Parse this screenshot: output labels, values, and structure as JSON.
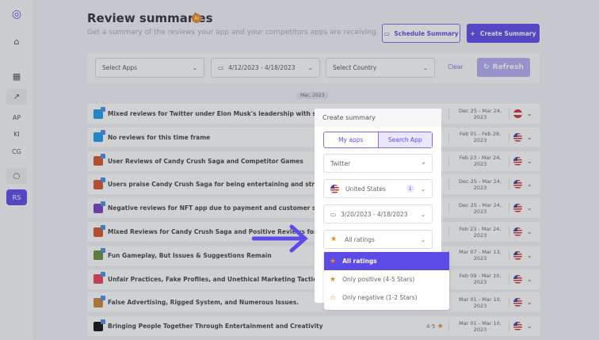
{
  "sidebar": {
    "items": [
      {
        "label": "AP"
      },
      {
        "label": "KI"
      },
      {
        "label": "CG"
      },
      {
        "label": "RS"
      }
    ]
  },
  "header": {
    "title": "Review summaries",
    "badge": "AI",
    "subtitle": "Get a summary of the reviews your app and your competitors apps are receiving.",
    "schedule_label": "Schedule Summary",
    "create_label": "Create Summary"
  },
  "filters": {
    "apps_placeholder": "Select Apps",
    "date_range": "4/12/2023 - 4/18/2023",
    "country_placeholder": "Select Country",
    "clear_label": "Clear",
    "refresh_label": "Refresh"
  },
  "month_label": "Mar, 2023",
  "rows": [
    {
      "title": "Mixed reviews for Twitter under Elon Musk's leadership with some users experiencing issues",
      "dates": "Dec 25 - Mar 24, 2023",
      "flag": "austria",
      "icon": "#1d9bf0"
    },
    {
      "title": "No reviews for this time frame",
      "dates": "Feb 01 - Feb 28, 2023",
      "flag": "us",
      "icon": "#1d9bf0"
    },
    {
      "title": "User Reviews of Candy Crush Saga and Competitor Games",
      "dates": "Feb 23 - Mar 24, 2023",
      "flag": "us",
      "icon": "#d9532c"
    },
    {
      "title": "Users praise Candy Crush Saga for being entertaining and stress-relieving, but",
      "dates": "Dec 25 - Mar 24, 2023",
      "flag": "us",
      "icon": "#d9532c"
    },
    {
      "title": "Negative reviews for NFT app due to payment and customer service issues. Some",
      "dates": "Dec 25 - Mar 24, 2023",
      "flag": "us",
      "icon": "#7b3fbf"
    },
    {
      "title": "Mixed Reviews for Candy Crush Saga and Positive Reviews for Mobile Puzzle Games",
      "dates": "Feb 23 - Mar 24, 2023",
      "flag": "us",
      "icon": "#d9532c"
    },
    {
      "title": "Fun Gameplay, But Issues & Suggestions Remain",
      "dates": "Mar 07 - Mar 13, 2023",
      "flag": "us",
      "icon": "#6b8e3a"
    },
    {
      "title": "Unfair Practices, Fake Profiles, and Unethical Marketing Tactics.",
      "dates": "Feb 09 - Mar 10, 2023",
      "flag": "us",
      "icon": "#e8465a"
    },
    {
      "title": "False Advertising, Rigged System, and Numerous Issues.",
      "dates": "Mar 01 - Mar 10, 2023",
      "flag": "us",
      "icon": "#c9873a"
    },
    {
      "title": "Bringing People Together Through Entertainment and Creativity",
      "dates": "Mar 01 - Mar 10, 2023",
      "flag": "us",
      "icon": "#111111",
      "rating": "4-5"
    }
  ],
  "modal": {
    "title": "Create summary",
    "tabs": [
      "My apps",
      "Search App"
    ],
    "active_tab": "Search App",
    "search_value": "Twitter",
    "country": "United States",
    "country_count": "1",
    "date_range": "3/20/2023 - 4/18/2023",
    "rating": "All ratings",
    "rating_options": [
      "All ratings",
      "Only positive (4-5 Stars)",
      "Only negative (1-2 Stars)"
    ]
  },
  "colors": {
    "accent": "#5b4ce8",
    "badge": "#f08a24"
  }
}
